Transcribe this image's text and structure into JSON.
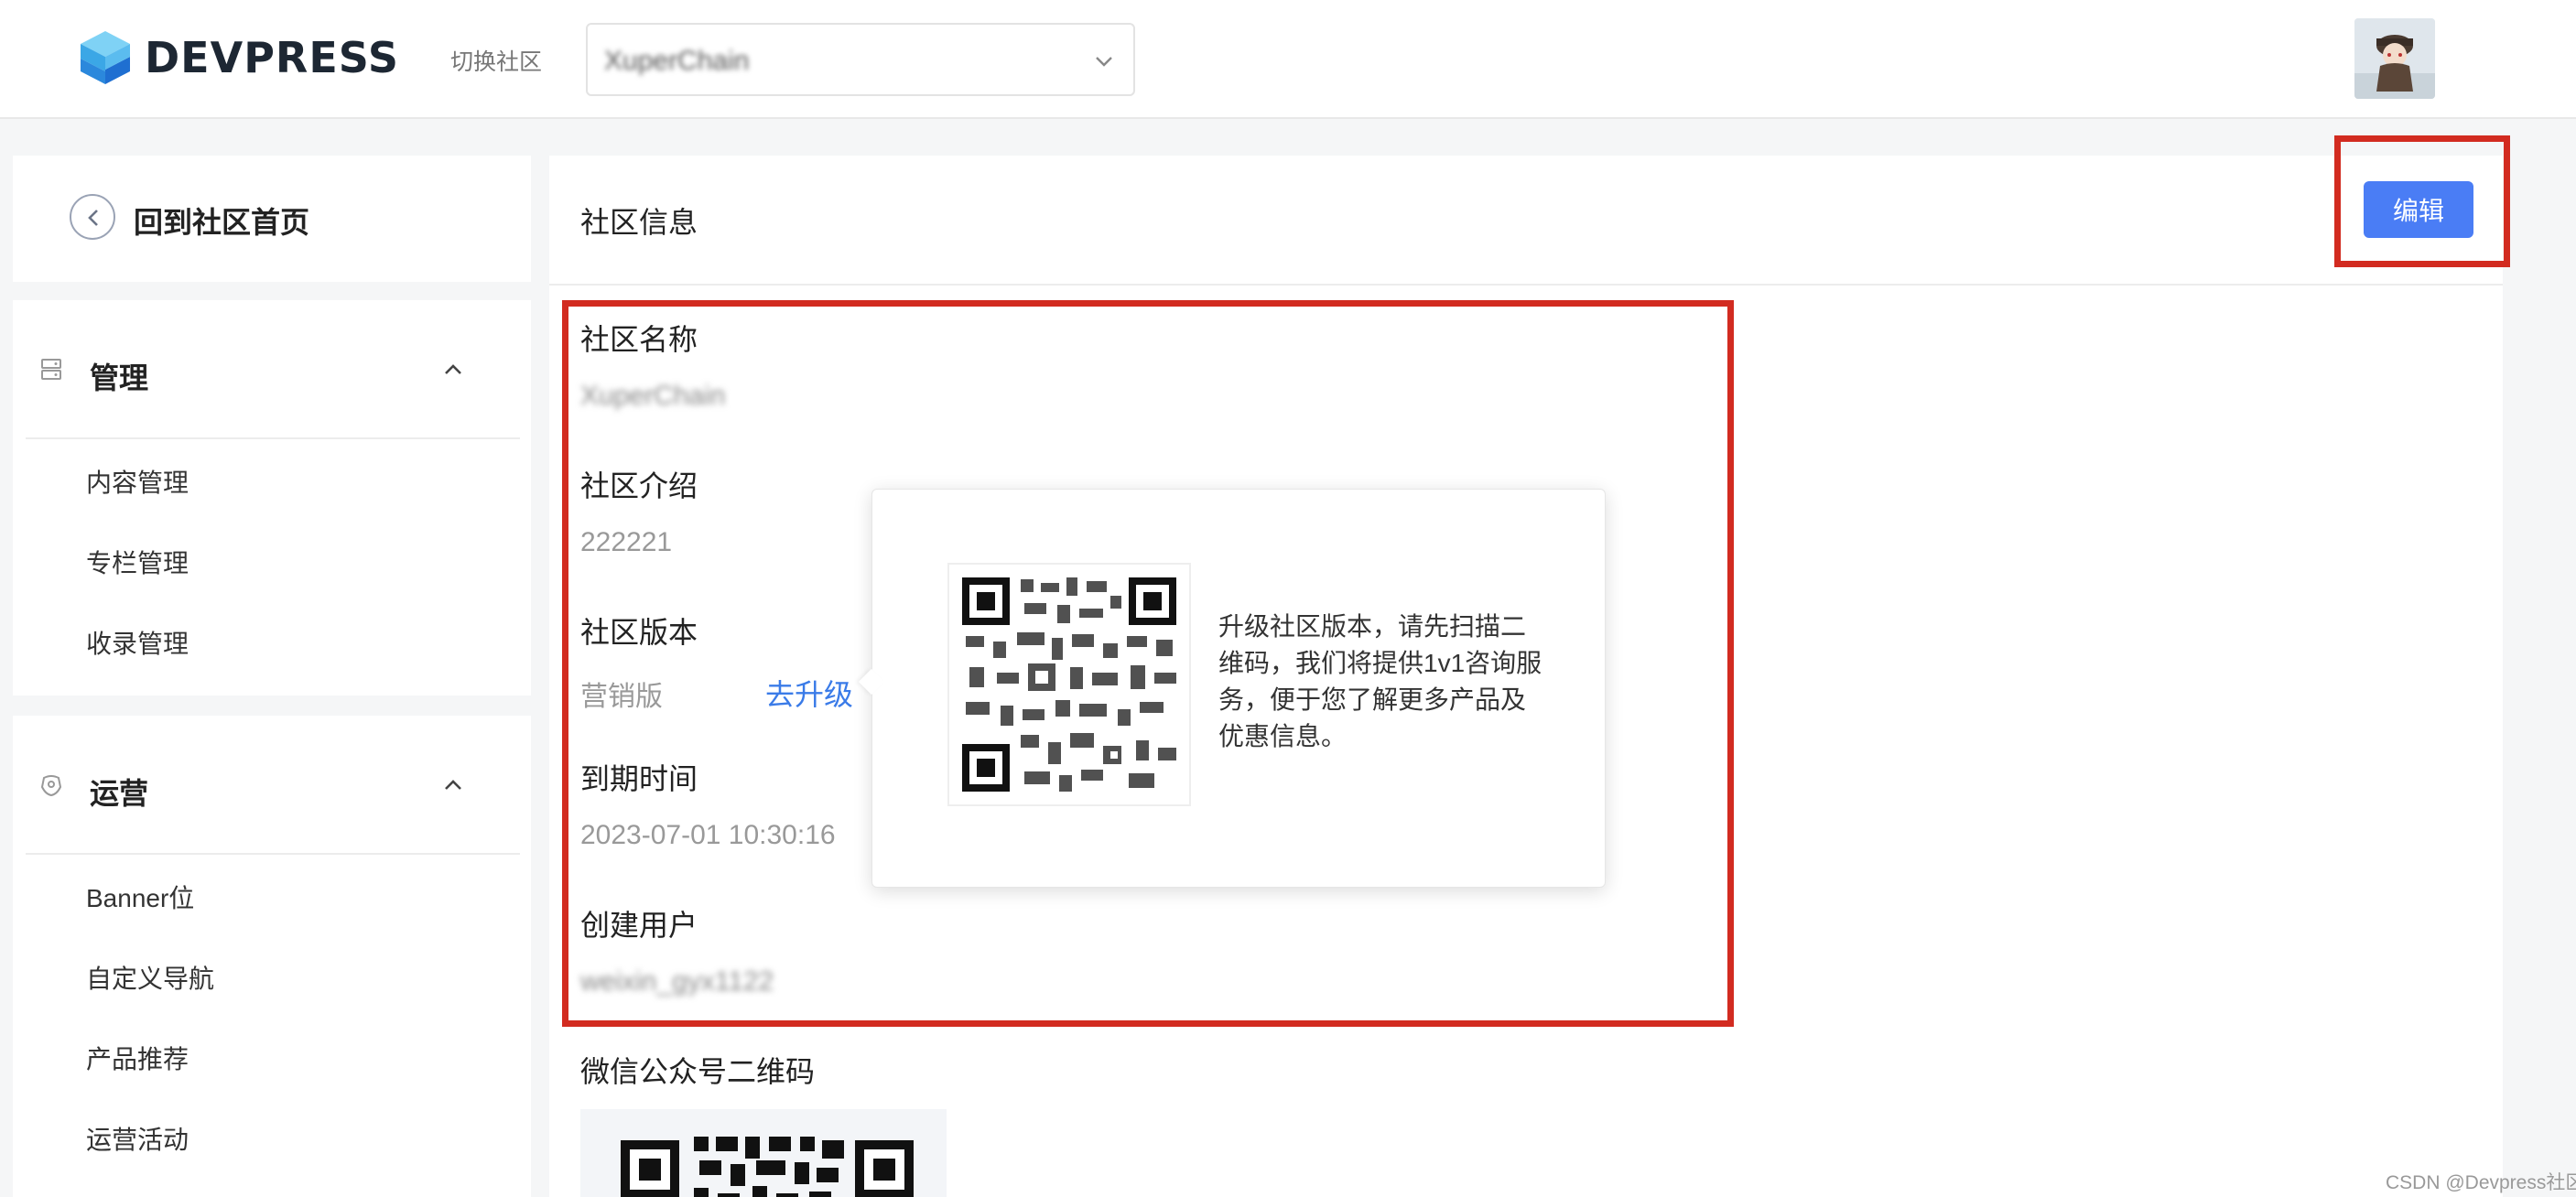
{
  "header": {
    "logo_text": "DEVPRESS",
    "switch_label": "切换社区",
    "community_selected": "XuperChain"
  },
  "sidebar": {
    "back_label": "回到社区首页",
    "groups": [
      {
        "title": "管理",
        "icon": "server-icon",
        "expanded": true,
        "items": [
          "内容管理",
          "专栏管理",
          "收录管理"
        ]
      },
      {
        "title": "运营",
        "icon": "operations-icon",
        "expanded": true,
        "items": [
          "Banner位",
          "自定义导航",
          "产品推荐",
          "运营活动"
        ]
      }
    ]
  },
  "main": {
    "title": "社区信息",
    "edit_label": "编辑",
    "fields": {
      "name_label": "社区名称",
      "name_value": "XuperChain",
      "intro_label": "社区介绍",
      "intro_value": "222221",
      "version_label": "社区版本",
      "version_value": "营销版",
      "upgrade_label": "去升级",
      "expire_label": "到期时间",
      "expire_value": "2023-07-01 10:30:16",
      "creator_label": "创建用户",
      "creator_value": "weixin_gyx1122",
      "wechat_qr_label": "微信公众号二维码"
    },
    "popover": {
      "text": "升级社区版本，请先扫描二维码，我们将提供1v1咨询服务，便于您了解更多产品及优惠信息。"
    }
  },
  "watermark": "CSDN @Devpress社区",
  "colors": {
    "accent": "#4a7df5",
    "link": "#3a7be8",
    "highlight": "#d22b20"
  }
}
